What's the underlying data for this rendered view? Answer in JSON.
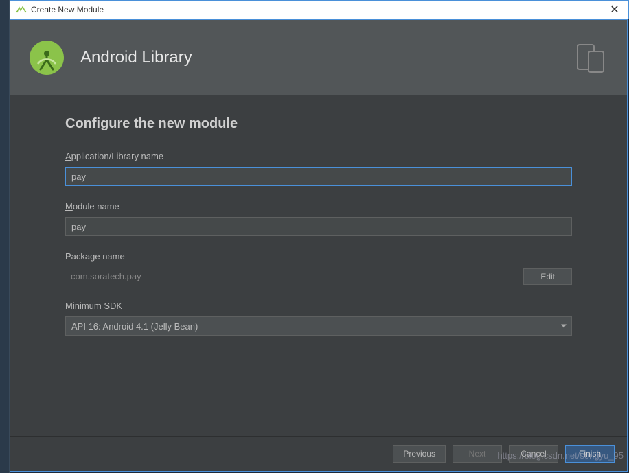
{
  "window": {
    "title": "Create New Module"
  },
  "header": {
    "title": "Android Library"
  },
  "section": {
    "title": "Configure the new module"
  },
  "fields": {
    "app_name": {
      "label_prefix": "A",
      "label_rest": "pplication/Library name",
      "value": "pay"
    },
    "module_name": {
      "label_prefix": "M",
      "label_rest": "odule name",
      "value": "pay"
    },
    "package_name": {
      "label": "Package name",
      "value": "com.soratech.pay",
      "edit_label": "Edit"
    },
    "min_sdk": {
      "label": "Minimum SDK",
      "value": "API 16: Android 4.1 (Jelly Bean)"
    }
  },
  "footer": {
    "previous": "Previous",
    "next": "Next",
    "cancel": "Cancel",
    "finish": "Finish"
  },
  "watermark": "https://blog.csdn.net/songyu_95"
}
